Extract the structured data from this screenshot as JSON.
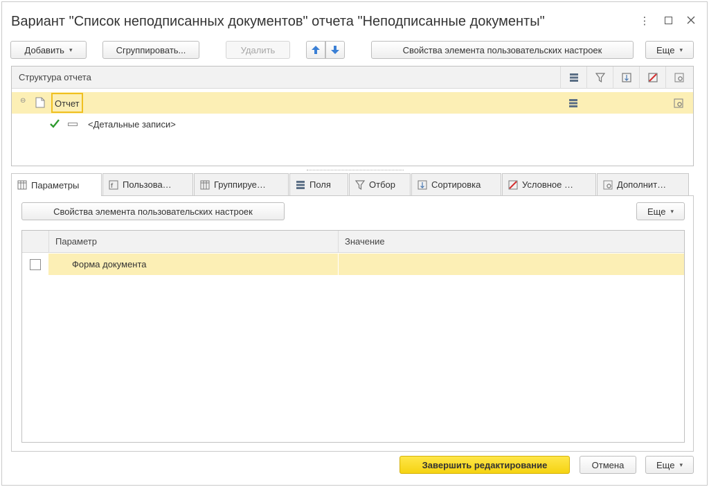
{
  "window": {
    "title": "Вариант \"Список неподписанных документов\" отчета \"Неподписанные документы\"",
    "controls": [
      "more-vertical-icon",
      "maximize-icon",
      "close-icon"
    ]
  },
  "toolbar": {
    "add_label": "Добавить",
    "group_label": "Сгруппировать...",
    "delete_label": "Удалить",
    "properties_label": "Свойства элемента пользовательских настроек",
    "more_label": "Еще"
  },
  "structure": {
    "header": "Структура отчета",
    "column_icons": [
      "fields-icon",
      "filter-icon",
      "sort-icon",
      "conditional-format-icon",
      "other-settings-icon"
    ],
    "rows": [
      {
        "label": "Отчет"
      },
      {
        "label": "<Детальные записи>",
        "checked": true
      }
    ]
  },
  "tabs": [
    {
      "label": "Параметры",
      "icon": "parameters-icon",
      "active": true
    },
    {
      "label": "Пользова…",
      "icon": "user-fields-icon"
    },
    {
      "label": "Группируе…",
      "icon": "grouping-icon"
    },
    {
      "label": "Поля",
      "icon": "fields-icon"
    },
    {
      "label": "Отбор",
      "icon": "filter-icon"
    },
    {
      "label": "Сортировка",
      "icon": "sort-icon"
    },
    {
      "label": "Условное …",
      "icon": "conditional-format-icon"
    },
    {
      "label": "Дополнит…",
      "icon": "other-settings-icon"
    }
  ],
  "params": {
    "properties_label": "Свойства элемента пользовательских настроек",
    "more_label": "Еще",
    "columns": [
      "Параметр",
      "Значение"
    ],
    "rows": [
      {
        "param": "Форма документа",
        "value": "",
        "checked": false
      }
    ]
  },
  "footer": {
    "finish_label": "Завершить редактирование",
    "cancel_label": "Отмена",
    "more_label": "Еще"
  },
  "colors": {
    "accent_yellow": "#f5d312",
    "selection": "#fcefb5",
    "check_green": "#2e9a2e",
    "arrow_blue": "#3a7fd5"
  }
}
